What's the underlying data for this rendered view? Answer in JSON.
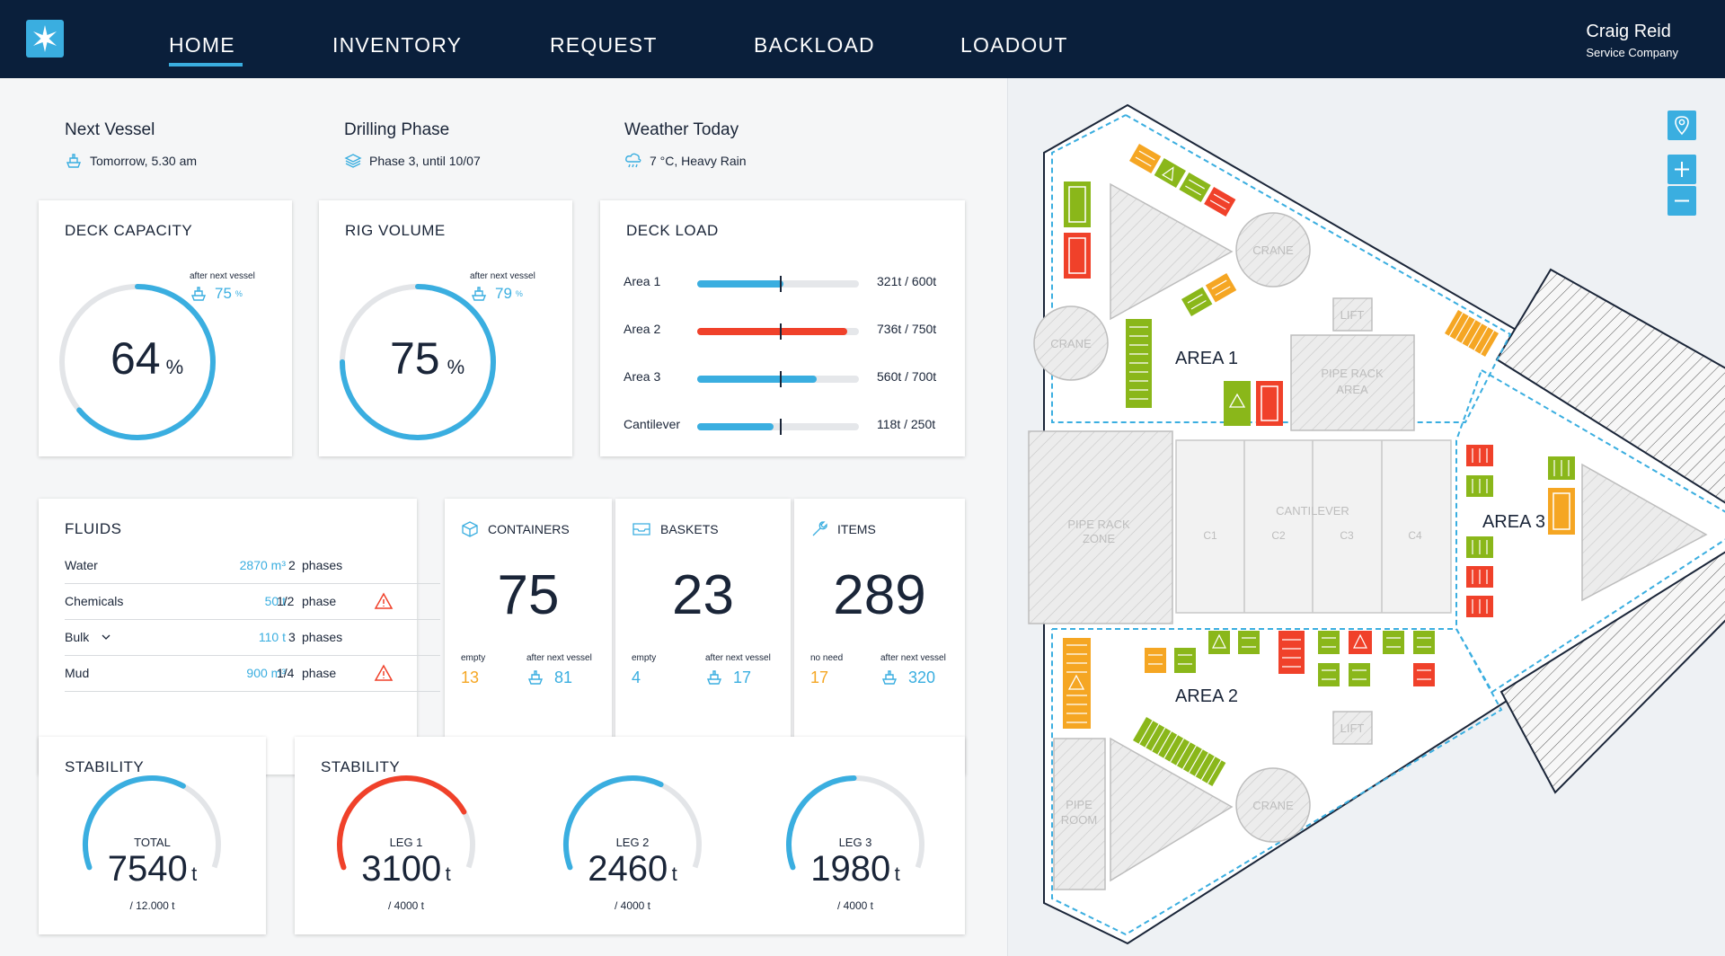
{
  "nav": {
    "items": [
      "HOME",
      "INVENTORY",
      "REQUEST",
      "BACKLOAD",
      "LOADOUT"
    ],
    "active": "HOME"
  },
  "user": {
    "name": "Craig Reid",
    "role": "Service Company"
  },
  "info": {
    "next_vessel": {
      "title": "Next Vessel",
      "value": "Tomorrow, 5.30 am"
    },
    "drilling_phase": {
      "title": "Drilling Phase",
      "value": "Phase 3, until 10/07"
    },
    "weather": {
      "title": "Weather Today",
      "value": "7 °C, Heavy Rain"
    }
  },
  "deck_capacity": {
    "title": "DECK CAPACITY",
    "value": "64",
    "unit": "%",
    "after_label": "after next vessel",
    "after_value": "75",
    "after_unit": "%",
    "fraction": 0.64,
    "after_fraction": 0.75
  },
  "rig_volume": {
    "title": "RIG VOLUME",
    "value": "75",
    "unit": "%",
    "after_label": "after next vessel",
    "after_value": "79",
    "after_unit": "%",
    "fraction": 0.75,
    "after_fraction": 0.79
  },
  "deck_load": {
    "title": "DECK LOAD",
    "rows": [
      {
        "label": "Area 1",
        "value": "321t / 600t",
        "fraction": 0.535,
        "marker": 0.51,
        "color": "#3aaee0"
      },
      {
        "label": "Area 2",
        "value": "736t / 750t",
        "fraction": 0.93,
        "marker": 0.51,
        "color": "#f0412a"
      },
      {
        "label": "Area 3",
        "value": "560t / 700t",
        "fraction": 0.74,
        "marker": 0.51,
        "color": "#3aaee0"
      },
      {
        "label": "Cantilever",
        "value": "118t / 250t",
        "fraction": 0.47,
        "marker": 0.51,
        "color": "#3aaee0"
      }
    ]
  },
  "fluids": {
    "title": "FLUIDS",
    "rows": [
      {
        "name": "Water",
        "amount": "2870 m³",
        "phase_num": "2",
        "phase_lbl": "phases",
        "warning": false
      },
      {
        "name": "Chemicals",
        "amount": "50 t",
        "phase_num": "1/2",
        "phase_lbl": "phase",
        "warning": true
      },
      {
        "name": "Bulk",
        "amount": "110 t",
        "phase_num": "3",
        "phase_lbl": "phases",
        "warning": false
      },
      {
        "name": "Mud",
        "amount": "900 m³",
        "phase_num": "1/4",
        "phase_lbl": "phase",
        "warning": true
      }
    ]
  },
  "containers": {
    "label": "CONTAINERS",
    "value": "75",
    "left_lbl": "empty",
    "left_val": "13",
    "right_lbl": "after next vessel",
    "right_val": "81"
  },
  "baskets": {
    "label": "BASKETS",
    "value": "23",
    "left_lbl": "empty",
    "left_val": "4",
    "right_lbl": "after next vessel",
    "right_val": "17"
  },
  "items": {
    "label": "ITEMS",
    "value": "289",
    "left_lbl": "no need",
    "left_val": "17",
    "right_lbl": "after next vessel",
    "right_val": "320"
  },
  "stability_total": {
    "title": "STABILITY",
    "label": "TOTAL",
    "value": "7540",
    "unit": "t",
    "max": "/ 12.000 t",
    "fraction": 0.628,
    "color": "#3aaee0"
  },
  "stability_legs": {
    "title": "STABILITY",
    "legs": [
      {
        "label": "LEG 1",
        "value": "3100",
        "unit": "t",
        "max": "/ 4000 t",
        "fraction": 0.775,
        "color": "#f0412a"
      },
      {
        "label": "LEG 2",
        "value": "2460",
        "unit": "t",
        "max": "/ 4000 t",
        "fraction": 0.615,
        "color": "#3aaee0"
      },
      {
        "label": "LEG 3",
        "value": "1980",
        "unit": "t",
        "max": "/ 4000 t",
        "fraction": 0.495,
        "color": "#3aaee0"
      }
    ]
  },
  "map": {
    "area_labels": [
      "AREA 1",
      "AREA 2",
      "AREA 3"
    ],
    "crane": "CRANE",
    "lift": "LIFT",
    "pipe_rack_area": [
      "PIPE RACK",
      "AREA"
    ],
    "pipe_rack_zone": [
      "PIPE RACK",
      "ZONE"
    ],
    "pipe_room": [
      "PIPE",
      "ROOM"
    ],
    "cantilever": "CANTILEVER",
    "bays": [
      "C1",
      "C2",
      "C3",
      "C4"
    ],
    "colors": {
      "green": "#8ab71a",
      "red": "#f0412a",
      "orange": "#f5a623",
      "hatch": "#d9d9d9",
      "blue": "#3aaee0"
    }
  }
}
